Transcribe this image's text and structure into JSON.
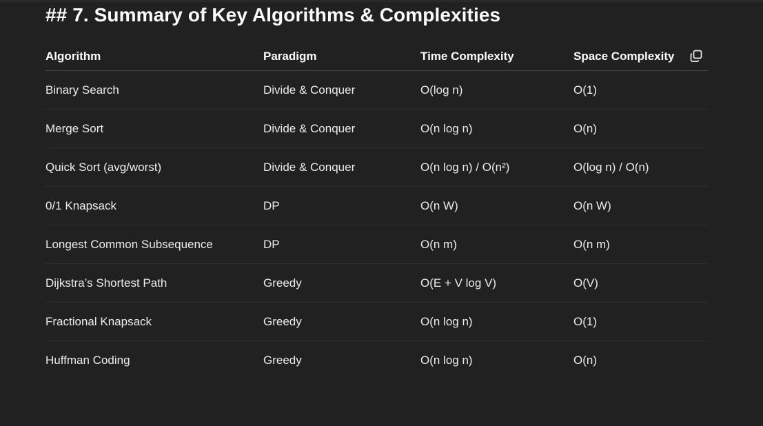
{
  "heading": "## 7. Summary of Key Algorithms & Complexities",
  "table": {
    "headers": [
      "Algorithm",
      "Paradigm",
      "Time Complexity",
      "Space Complexity"
    ],
    "rows": [
      [
        "Binary Search",
        "Divide & Conquer",
        "O(log n)",
        "O(1)"
      ],
      [
        "Merge Sort",
        "Divide & Conquer",
        "O(n log n)",
        "O(n)"
      ],
      [
        "Quick Sort (avg/worst)",
        "Divide & Conquer",
        "O(n log n) / O(n²)",
        "O(log n) / O(n)"
      ],
      [
        "0/1 Knapsack",
        "DP",
        "O(n W)",
        "O(n W)"
      ],
      [
        "Longest Common Subsequence",
        "DP",
        "O(n m)",
        "O(n m)"
      ],
      [
        "Dijkstra’s Shortest Path",
        "Greedy",
        "O(E + V log V)",
        "O(V)"
      ],
      [
        "Fractional Knapsack",
        "Greedy",
        "O(n log n)",
        "O(1)"
      ],
      [
        "Huffman Coding",
        "Greedy",
        "O(n log n)",
        "O(n)"
      ]
    ]
  },
  "icons": {
    "copy": "copy-icon"
  },
  "colors": {
    "background": "#212121",
    "text": "#ececec",
    "heading": "#ffffff",
    "divider": "#303030"
  }
}
